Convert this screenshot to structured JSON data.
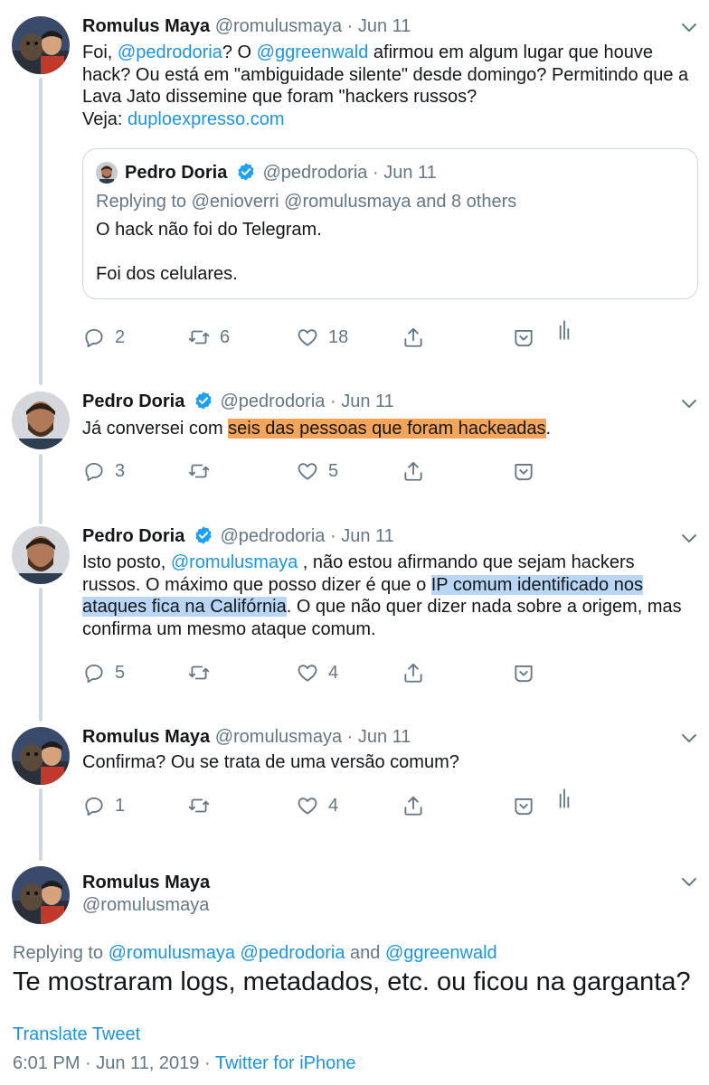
{
  "tweets": [
    {
      "name": "Romulus Maya",
      "handle": "@romulusmaya",
      "dot": "·",
      "date": "Jun 11",
      "text": {
        "p1": "Foi, ",
        "m1": "@pedrodoria",
        "p2": "? O ",
        "m2": "@ggreenwald",
        "p3": " afirmou em algum lugar que houve hack? Ou está em \"ambiguidade silente\" desde domingo? Permitindo que a Lava Jato dissemine que foram \"hackers russos?",
        "p4": "Veja: ",
        "link": "duploexpresso.com"
      },
      "quote": {
        "name": "Pedro Doria",
        "handle": "@pedrodoria",
        "dot": "·",
        "date": "Jun 11",
        "replying": "Replying to @enioverri @romulusmaya and 8 others",
        "line1": "O hack não foi do Telegram.",
        "line2": "Foi dos celulares."
      },
      "stats": {
        "replies": "2",
        "retweets": "6",
        "likes": "18"
      }
    },
    {
      "name": "Pedro Doria",
      "handle": "@pedrodoria",
      "dot": "·",
      "date": "Jun 11",
      "text": {
        "p1": "Já conversei com ",
        "hl": "seis das pessoas que foram hackeadas",
        "p2": "."
      },
      "stats": {
        "replies": "3",
        "retweets": "",
        "likes": "5"
      }
    },
    {
      "name": "Pedro Doria",
      "handle": "@pedrodoria",
      "dot": "·",
      "date": "Jun 11",
      "text": {
        "p1": "Isto posto, ",
        "m1": "@romulusmaya",
        "p2": " , não estou afirmando que sejam hackers russos. O máximo que posso dizer é que o ",
        "hl": "IP comum identificado nos ataques fica na Califórnia",
        "p3": ". O que não quer dizer nada sobre a origem, mas confirma um mesmo ataque comum."
      },
      "stats": {
        "replies": "5",
        "retweets": "",
        "likes": "4"
      }
    },
    {
      "name": "Romulus Maya",
      "handle": "@romulusmaya",
      "dot": "·",
      "date": "Jun 11",
      "text": "Confirma? Ou se trata de uma versão comum?",
      "stats": {
        "replies": "1",
        "retweets": "",
        "likes": "4"
      }
    }
  ],
  "main": {
    "name": "Romulus Maya",
    "handle": "@romulusmaya",
    "replying_prefix": "Replying to ",
    "replying_handles": "@romulusmaya @pedrodoria",
    "replying_and": " and ",
    "replying_last": "@ggreenwald",
    "text": "Te mostraram logs, metadados, etc. ou ficou na garganta?",
    "translate": "Translate Tweet",
    "time": "6:01 PM · Jun 11, 2019 · ",
    "source": "Twitter for iPhone"
  },
  "colors": {
    "link": "#1b95e0",
    "verified": "#1da1f2",
    "secondary": "#657786",
    "highlight_orange": "#f5a55a",
    "highlight_blue": "#b9d6f5"
  },
  "icons": [
    "reply-icon",
    "retweet-icon",
    "like-icon",
    "share-icon",
    "heart-in-box-icon",
    "analytics-icon",
    "verified-badge-icon",
    "chevron-down-icon"
  ]
}
